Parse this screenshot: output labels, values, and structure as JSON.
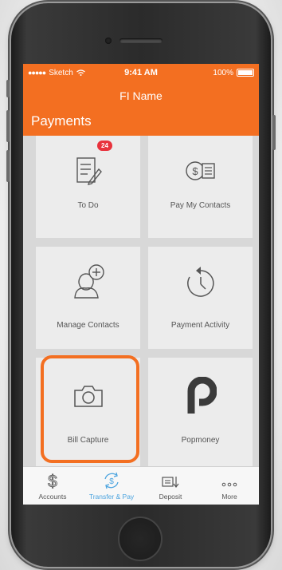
{
  "status_bar": {
    "carrier": "Sketch",
    "time": "9:41 AM",
    "battery": "100%"
  },
  "nav": {
    "title": "FI Name"
  },
  "section": {
    "title": "Payments"
  },
  "tiles": [
    {
      "label": "To Do",
      "icon": "todo-list-icon",
      "badge": "24"
    },
    {
      "label": "Pay My Contacts",
      "icon": "money-card-icon"
    },
    {
      "label": "Manage Contacts",
      "icon": "add-contact-icon"
    },
    {
      "label": "Payment Activity",
      "icon": "history-clock-icon"
    },
    {
      "label": "Bill Capture",
      "icon": "camera-icon",
      "highlighted": true
    },
    {
      "label": "Popmoney",
      "icon": "popmoney-logo-icon"
    }
  ],
  "tabs": [
    {
      "label": "Accounts",
      "icon": "dollar-icon",
      "active": false
    },
    {
      "label": "Transfer & Pay",
      "icon": "transfer-pay-icon",
      "active": true
    },
    {
      "label": "Deposit",
      "icon": "check-deposit-icon",
      "active": false
    },
    {
      "label": "More",
      "icon": "more-dots-icon",
      "active": false
    }
  ],
  "colors": {
    "brand_orange": "#f36f21",
    "tab_active": "#4aa3df",
    "badge_red": "#e8323c"
  }
}
